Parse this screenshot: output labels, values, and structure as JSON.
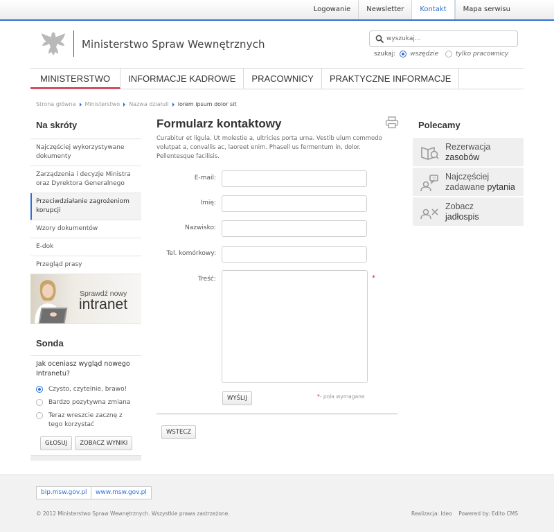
{
  "topnav": [
    {
      "label": "Logowanie",
      "active": false
    },
    {
      "label": "Newsletter",
      "active": false
    },
    {
      "label": "Kontakt",
      "active": true
    },
    {
      "label": "Mapa serwisu",
      "active": false
    }
  ],
  "header": {
    "title": "Ministerstwo Spraw Wewnętrznych"
  },
  "search": {
    "placeholder": "wyszukaj...",
    "scope_label": "szukaj:",
    "options": [
      {
        "label": "wszędzie",
        "selected": true
      },
      {
        "label": "tylko pracownicy",
        "selected": false
      }
    ]
  },
  "mainnav": [
    {
      "label": "MINISTERSTWO",
      "active": true
    },
    {
      "label": "INFORMACJE KADROWE",
      "active": false
    },
    {
      "label": "PRACOWNICY",
      "active": false
    },
    {
      "label": "PRAKTYCZNE INFORMACJE",
      "active": false
    }
  ],
  "breadcrumb": [
    "Strona główna",
    "Ministerstwo",
    "Nazwa działuII",
    "lorem ipsum dolor sit"
  ],
  "shortcuts": {
    "title": "Na skróty",
    "items": [
      {
        "label": "Najczęściej wykorzystywane dokumenty",
        "active": false
      },
      {
        "label": "Zarządzenia i decyzje Ministra oraz Dyrektora Generalnego",
        "active": false
      },
      {
        "label": "Przeciwdziałanie zagrożeniom korupcji",
        "active": true
      },
      {
        "label": "Wzory dokumentów",
        "active": false
      },
      {
        "label": "E-dok",
        "active": false
      },
      {
        "label": "Przegląd prasy",
        "active": false
      }
    ]
  },
  "banner": {
    "line1": "Sprawdź nowy",
    "line2": "intranet"
  },
  "poll": {
    "title": "Sonda",
    "question": "Jak oceniasz wygląd nowego Intranetu?",
    "answers": [
      {
        "label": "Czysto, czytelnie, brawo!",
        "selected": true
      },
      {
        "label": "Bardzo pozytywna zmiana",
        "selected": false
      },
      {
        "label": "Teraz wreszcie zacznę z tego korzystać",
        "selected": false
      }
    ],
    "vote_label": "GŁOSUJ",
    "results_label": "ZOBACZ WYNIKI"
  },
  "form": {
    "title": "Formularz kontaktowy",
    "intro": "Curabitur et ligula. Ut molestie a, ultricies porta urna. Vestib ulum commodo volutpat a, convallis ac, laoreet enim. Phasell us fermentum in, dolor. Pellentesque facilisis.",
    "email_label": "E-mail:",
    "firstname_label": "Imię:",
    "lastname_label": "Nazwisko:",
    "phone_label": "Tel. komórkowy:",
    "message_label": "Treść:",
    "required_mark": "*",
    "submit_label": "WYŚLIJ",
    "required_note": "- pola wymagane",
    "back_label": "WSTECZ"
  },
  "recommended": {
    "title": "Polecamy",
    "items": [
      {
        "line1": "Rezerwacja",
        "line2": "zasobów"
      },
      {
        "line1": "Najczęściej",
        "line2a": "zadawane ",
        "line2b": "pytania"
      },
      {
        "line1": "Zobacz",
        "line2": "jadłospis"
      }
    ]
  },
  "footer": {
    "links": [
      "bip.msw.gov.pl",
      "www.msw.gov.pl"
    ],
    "copyright": "© 2012 Ministerstwo Spraw Wewnętrznych. Wszystkie prawa zastrzeżone.",
    "credits": "Realizacja: Ideo    Powered by: Edito CMS"
  },
  "colors": {
    "accent": "#2f6fd1",
    "brand_red": "#d4213d"
  }
}
